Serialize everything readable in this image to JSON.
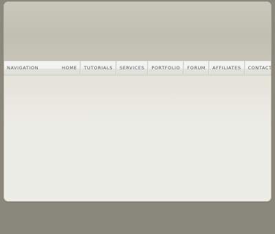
{
  "navigation": {
    "title": "Navigation",
    "items": [
      {
        "label": "Home"
      },
      {
        "label": "Tutorials"
      },
      {
        "label": "Services"
      },
      {
        "label": "Portfolio"
      },
      {
        "label": "Forum"
      },
      {
        "label": "Affiliates"
      },
      {
        "label": "Contacts"
      }
    ]
  },
  "colors": {
    "page_background": "#8a887c",
    "header_background": "#c3c2b4",
    "nav_bar": "#f2f2f0",
    "content_background": "#edede7"
  }
}
